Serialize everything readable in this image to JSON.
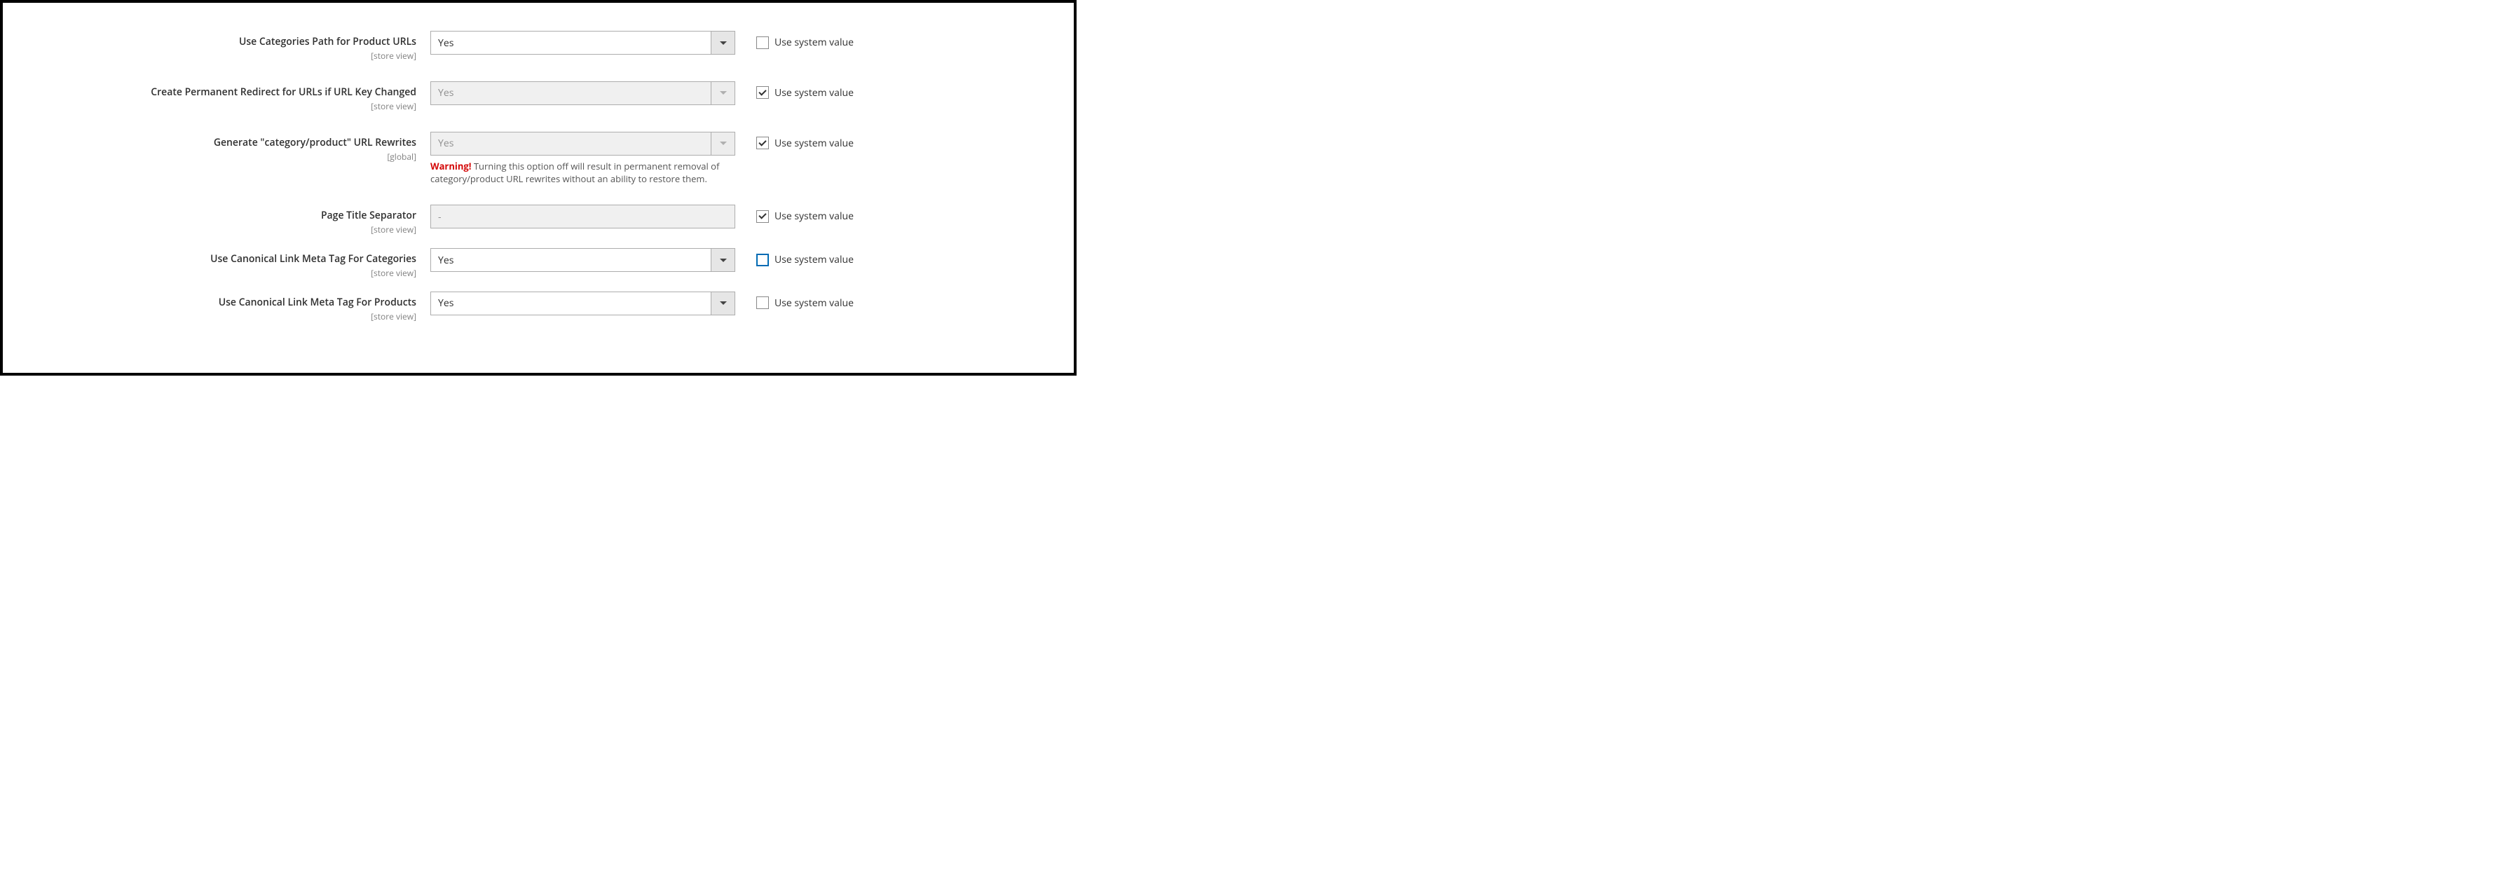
{
  "system_value_label": "Use system value",
  "fields": {
    "categories_path": {
      "label": "Use Categories Path for Product URLs",
      "scope": "[store view]",
      "value": "Yes"
    },
    "permanent_redirect": {
      "label": "Create Permanent Redirect for URLs if URL Key Changed",
      "scope": "[store view]",
      "value": "Yes"
    },
    "generate_rewrites": {
      "label": "Generate \"category/product\" URL Rewrites",
      "scope": "[global]",
      "value": "Yes",
      "warning_prefix": "Warning!",
      "warning_text": " Turning this option off will result in permanent removal of category/product URL rewrites without an ability to restore them."
    },
    "title_separator": {
      "label": "Page Title Separator",
      "scope": "[store view]",
      "value": "-"
    },
    "canonical_categories": {
      "label": "Use Canonical Link Meta Tag For Categories",
      "scope": "[store view]",
      "value": "Yes"
    },
    "canonical_products": {
      "label": "Use Canonical Link Meta Tag For Products",
      "scope": "[store view]",
      "value": "Yes"
    }
  }
}
